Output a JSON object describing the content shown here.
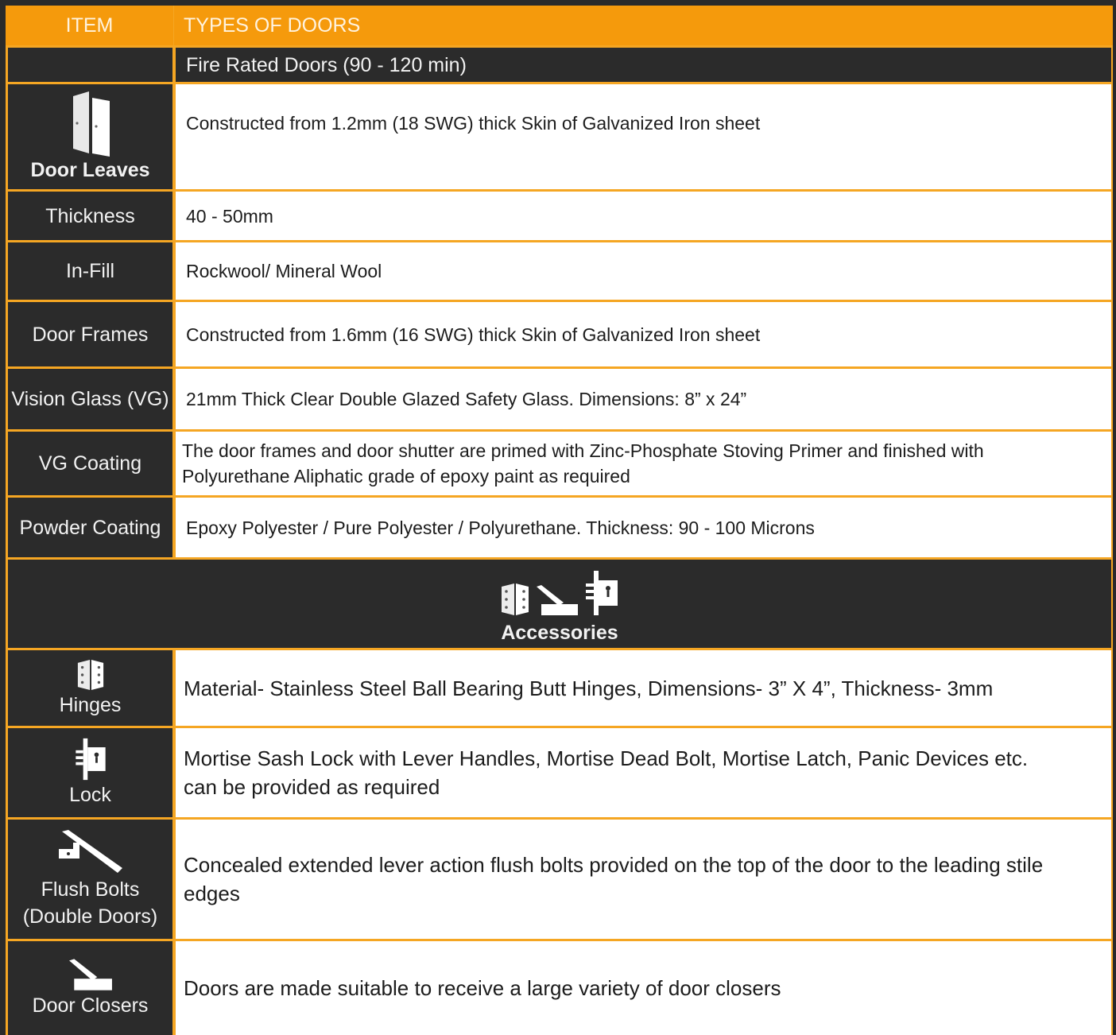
{
  "header": {
    "item_label": "ITEM",
    "types_label": "TYPES OF DOORS"
  },
  "subheader": {
    "door_type": "Fire Rated Doors (90 - 120 min)"
  },
  "specs": [
    {
      "item": "Door Leaves",
      "value": "Constructed from 1.2mm (18 SWG) thick Skin of Galvanized Iron sheet",
      "icon": "door-leaves-icon"
    },
    {
      "item": "Thickness",
      "value": "40 - 50mm"
    },
    {
      "item": "In-Fill",
      "value": "Rockwool/ Mineral Wool"
    },
    {
      "item": "Door Frames",
      "value": "Constructed from 1.6mm (16 SWG) thick Skin of Galvanized Iron sheet"
    },
    {
      "item": "Vision Glass (VG)",
      "value": "21mm Thick Clear Double Glazed Safety Glass. Dimensions: 8” x 24”"
    },
    {
      "item": "VG Coating",
      "value": "The door frames and door shutter are primed with Zinc-Phosphate Stoving Primer and finished with Polyurethane Aliphatic grade of epoxy paint as required"
    },
    {
      "item": "Powder Coating",
      "value": "Epoxy Polyester / Pure Polyester / Polyurethane. Thickness: 90 - 100 Microns"
    }
  ],
  "accessories": {
    "title": "Accessories",
    "icons": [
      "hinge-icon",
      "door-closer-icon",
      "lock-icon"
    ],
    "items": [
      {
        "item": "Hinges",
        "value": "Material- Stainless Steel Ball Bearing Butt Hinges, Dimensions- 3” X 4”, Thickness- 3mm",
        "icon": "hinge-icon"
      },
      {
        "item": "Lock",
        "value": "Mortise Sash Lock with Lever Handles, Mortise Dead Bolt, Mortise Latch, Panic Devices etc. can be provided as required",
        "icon": "lock-icon"
      },
      {
        "item_line1": "Flush Bolts",
        "item_line2": "(Double Doors)",
        "value": "Concealed extended lever action flush bolts provided on the top of the door to the leading stile edges",
        "icon": "flush-bolt-icon"
      },
      {
        "item": "Door Closers",
        "value": "Doors are made suitable to receive a large variety of door closers",
        "icon": "door-closer-icon"
      }
    ]
  },
  "colors": {
    "accent": "#f59a0c",
    "dark": "#2b2b2b",
    "cell": "#ffffff"
  }
}
